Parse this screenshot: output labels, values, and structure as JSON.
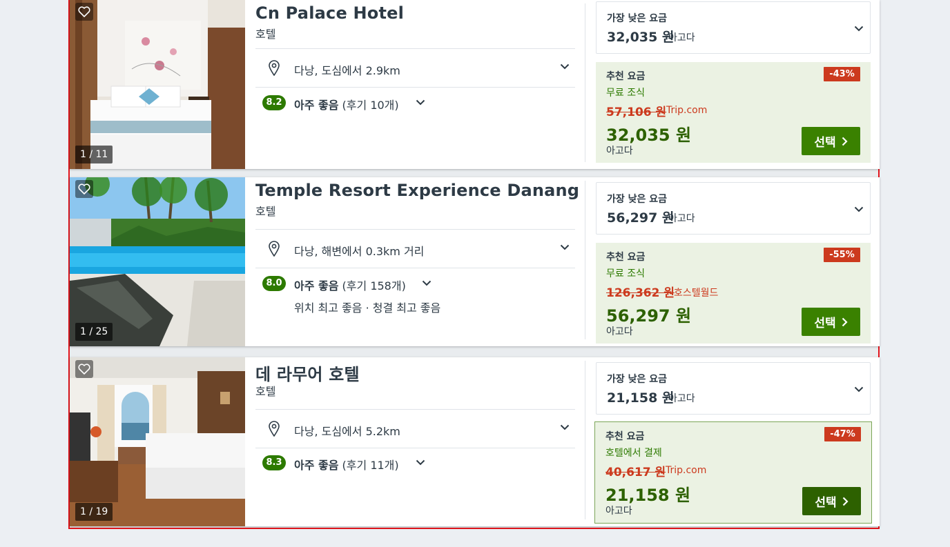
{
  "hotels": [
    {
      "name": "Cn Palace Hotel",
      "type": "호텔",
      "photo_counter": "1 / 11",
      "location": "다낭, 도심에서 2.9km",
      "rating": "8.2",
      "rating_word": "아주 좋음",
      "reviews": "(후기 10개)",
      "highlights": "",
      "lowest_label": "가장 낮은 요금",
      "lowest_price": "32,035 원",
      "lowest_provider": "아고다",
      "rec_label": "추천 요금",
      "discount": "-43%",
      "benefit": "무료 조식",
      "original_price": "57,106 원",
      "original_provider": "Trip.com",
      "rec_price": "32,035 원",
      "rec_provider": "아고다",
      "select_label": "선택"
    },
    {
      "name": "Temple Resort Experience Danang",
      "type": "호텔",
      "photo_counter": "1 / 25",
      "location": "다낭, 해변에서 0.3km 거리",
      "rating": "8.0",
      "rating_word": "아주 좋음",
      "reviews": "(후기 158개)",
      "highlights": "위치 최고 좋음 · 청결 최고 좋음",
      "lowest_label": "가장 낮은 요금",
      "lowest_price": "56,297 원",
      "lowest_provider": "아고다",
      "rec_label": "추천 요금",
      "discount": "-55%",
      "benefit": "무료 조식",
      "original_price": "126,362 원",
      "original_provider": "호스텔월드",
      "rec_price": "56,297 원",
      "rec_provider": "아고다",
      "select_label": "선택"
    },
    {
      "name": "데 라무어 호텔",
      "type": "호텔",
      "photo_counter": "1 / 19",
      "location": "다낭, 도심에서 5.2km",
      "rating": "8.3",
      "rating_word": "아주 좋음",
      "reviews": "(후기 11개)",
      "highlights": "",
      "lowest_label": "가장 낮은 요금",
      "lowest_price": "21,158 원",
      "lowest_provider": "아고다",
      "rec_label": "추천 요금",
      "discount": "-47%",
      "benefit": "호텔에서 결제",
      "original_price": "40,617 원",
      "original_provider": "Trip.com",
      "rec_price": "21,158 원",
      "rec_provider": "아고다",
      "select_label": "선택"
    }
  ],
  "icons": {
    "favorite": "heart-icon",
    "location": "map-pin-icon",
    "expand": "chevron-down-icon",
    "select_arrow": "chevron-right-icon"
  },
  "colors": {
    "rating_badge": "#2d7a00",
    "discount_badge": "#cc3a1e",
    "select_button": "#3a8100",
    "recommended_bg": "#ebf2e3",
    "selection_outline": "#e3141c"
  }
}
